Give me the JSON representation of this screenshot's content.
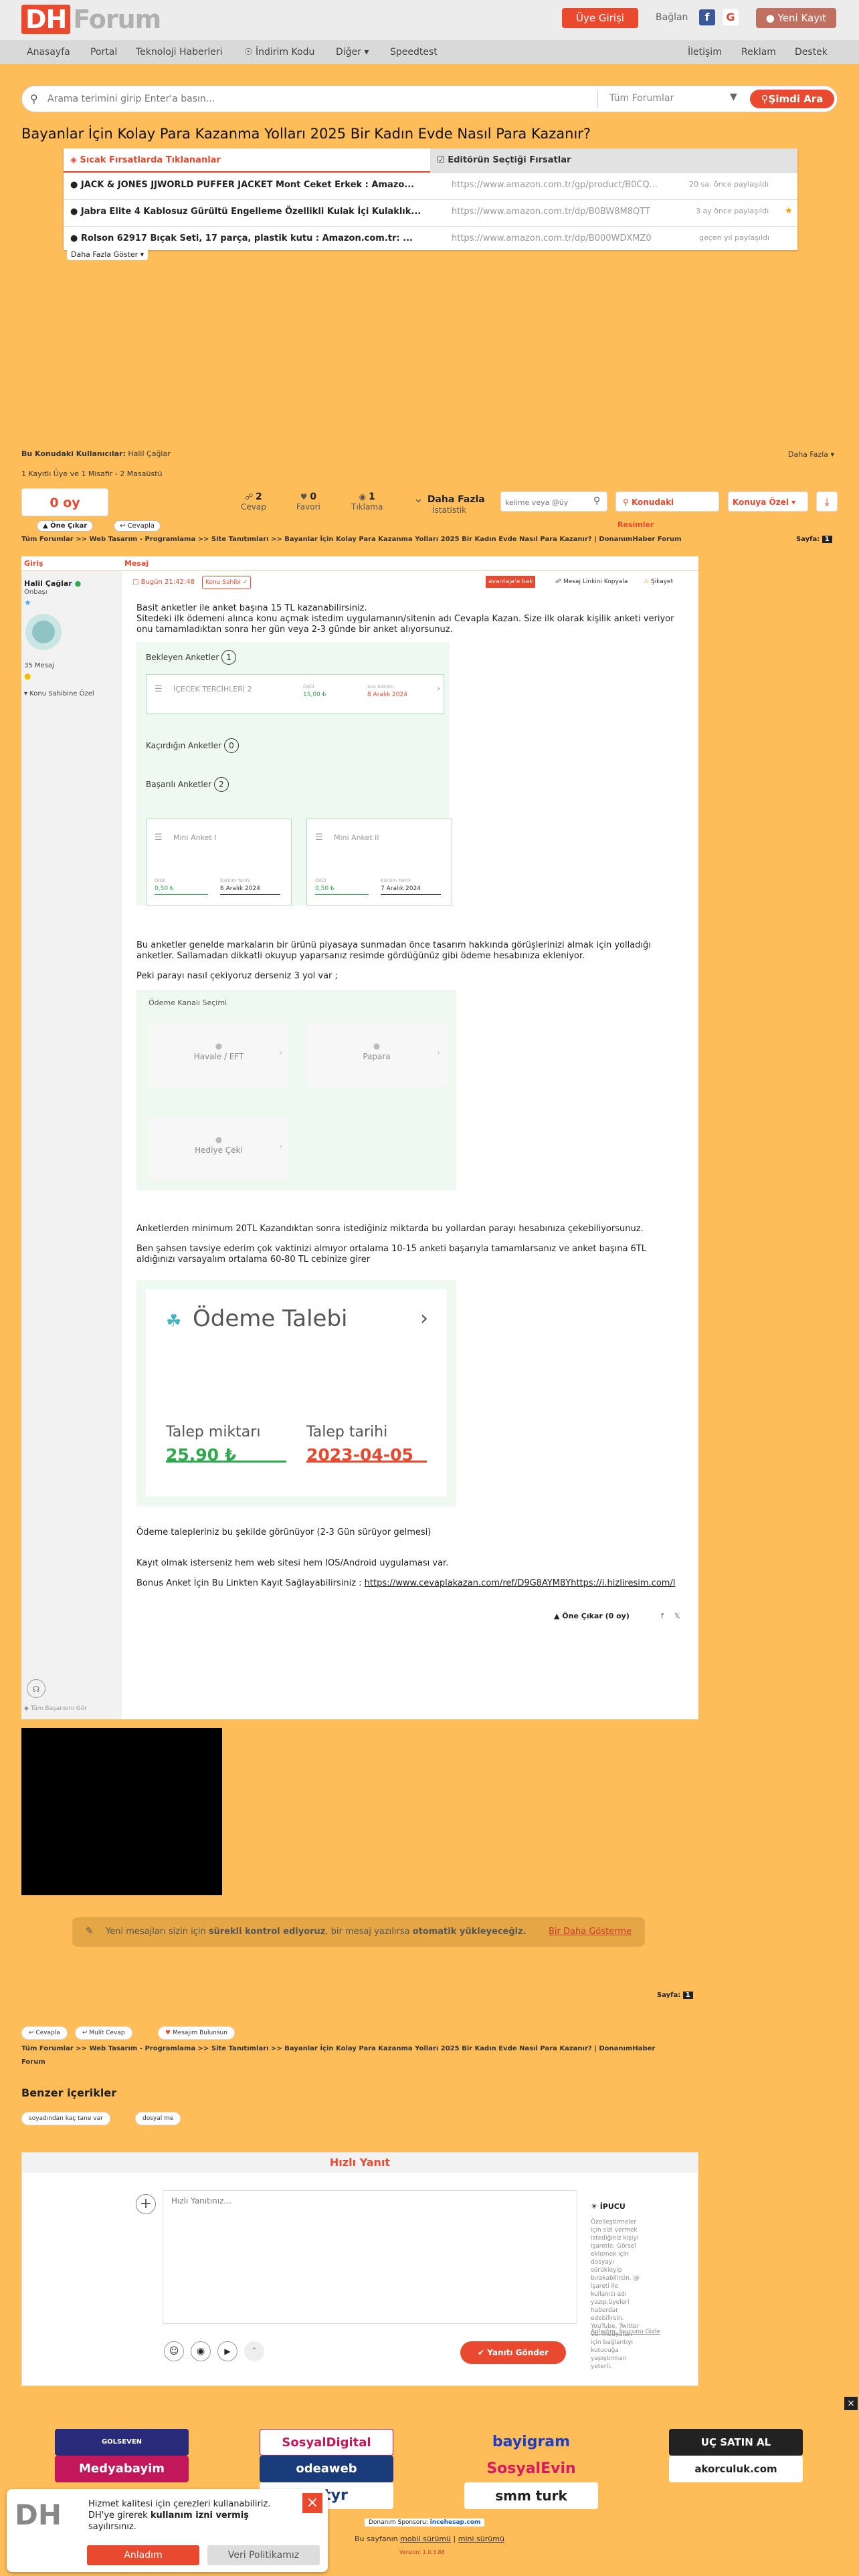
{
  "header": {
    "logo_dh": "DH",
    "logo_forum": "Forum",
    "login_button": "Üye Girişi",
    "connect_label": "Bağlan",
    "register_button": "Yeni Kayıt"
  },
  "nav": {
    "items": [
      "Anasayfa",
      "Portal",
      "Teknoloji Haberleri",
      "İndirim Kodu",
      "Diğer",
      "Speedtest"
    ],
    "right_items": [
      "İletişim",
      "Reklam",
      "Destek"
    ]
  },
  "search": {
    "placeholder": "Arama terimini girip Enter'a basın...",
    "scope": "Tüm Forumlar",
    "button": "Şimdi Ara"
  },
  "topic_title": "Bayanlar İçin Kolay Para Kazanma Yolları 2025 Bir Kadın Evde Nasıl Para Kazanır?",
  "hot_deals": {
    "tab_hot": "Sıcak Fırsatlarda Tıklananlar",
    "tab_editor": "Editörün Seçtiği Fırsatlar",
    "rows": [
      {
        "title": "JACK & JONES JJWORLD PUFFER JACKET Mont Ceket Erkek : Amazo...",
        "url": "https://www.amazon.com.tr/gp/product/B0CQ...",
        "time": "20 sa. önce paylaşıldı"
      },
      {
        "title": "Jabra Elite 4 Kablosuz Gürültü Engelleme Özellikli Kulak İçi Kulaklık...",
        "url": "https://www.amazon.com.tr/dp/B0BW8M8QTT",
        "time": "3 ay önce paylaşıldı"
      },
      {
        "title": "Rolson 62917 Bıçak Seti, 17 parça, plastik kutu : Amazon.com.tr: ...",
        "url": "https://www.amazon.com.tr/dp/B000WDXMZ0",
        "time": "geçen yıl paylaşıldı"
      }
    ],
    "more": "Daha Fazla Göster"
  },
  "viewers": {
    "label": "Bu Konudaki Kullanıcılar:",
    "user": "Halil Çağlar",
    "more": "Daha Fazla",
    "counts": "1 Kayıtlı Üye ve 1 Misafir - 2 Masaüstü"
  },
  "vote": {
    "score": "0 oy",
    "upvote": "Öne Çıkar",
    "answer": "Cevapla"
  },
  "stats": {
    "replies_value": "2",
    "replies_label": "Cevap",
    "favs_value": "0",
    "favs_label": "Favori",
    "clicks_value": "1",
    "clicks_label": "Tıklama",
    "more_label": "Daha Fazla",
    "more_sub": "İstatistik"
  },
  "topic_tools": {
    "keyword_placeholder": "kelime veya @üy",
    "subject_button": "Konudaki",
    "add_fav": "Konuya Özel",
    "images_label": "Resimler"
  },
  "breadcrumb": "Tüm Forumlar >> Web Tasarım - Programlama >> Site Tanıtımları >> Bayanlar İçin Kolay Para Kazanma Yolları 2025 Bir Kadın Evde Nasıl Para Kazanır? | DonanımHaber Forum",
  "breadcrumb_bottom": "Tüm Forumlar >> Web Tasarım - Programlama >> Site Tanıtımları >> Bayanlar İçin Kolay Para Kazanma Yolları 2025 Bir Kadın Evde Nasıl Para Kazanır? | DonanımHaber Forum",
  "page": {
    "label": "Sayfa:",
    "current": "1"
  },
  "post": {
    "col_user": "Giriş",
    "col_msg": "Mesaj",
    "date": "Bugün 21:42:48",
    "edit_badge": "Konu Sahibi",
    "warn": "avantaja'e bak",
    "copy_link": "Mesaj Linkini Kopyala",
    "report": "Şikayet",
    "username": "Halil Çağlar",
    "rank": "Onbaşı",
    "msg_count": "35 Mesaj",
    "user_menu": "Konu Sahibine Özel",
    "p1": "Basit anketler ile anket başına 15 TL kazanabilirsiniz.",
    "p2": "Sitedeki ilk ödemeni alınca konu açmak istedim uygulamanın/sitenin adı Cevapla Kazan. Size ilk olarak kişilik anketi veriyor onu tamamladıktan sonra her gün veya 2-3 günde bir anket alıyorsunuz.",
    "p3": "Bu anketler genelde markaların bir ürünü piyasaya sunmadan önce tasarım hakkında görüşlerinizi almak için yolladığı anketler. Sallamadan dikkatli okuyup yaparsanız resimde gördüğünüz gibi ödeme hesabınıza ekleniyor.",
    "p4": "Peki parayı nasıl çekiyoruz derseniz 3 yol var ;",
    "p5": "Anketlerden minimum 20TL Kazandıktan sonra istediğiniz miktarda bu yollardan parayı hesabınıza çekebiliyorsunuz.",
    "p6": "Ben şahsen tavsiye ederim çok vaktinizi almıyor ortalama 10-15 anketi başarıyla tamamlarsanız ve anket başına 6TL aldığınızı varsayalım ortalama 60-80 TL cebinize girer",
    "p7": "Ödeme talepleriniz bu şekilde görünüyor (2-3 Gün sürüyor gelmesi)",
    "p8": "Kayıt olmak isterseniz hem web sitesi hem IOS/Android uygulaması var.",
    "p9_label": "Bonus Anket İçin Bu Linkten Kayıt Sağlayabilirsiniz : ",
    "p9_link": "https://www.cevaplakazan.com/ref/D9G8AYM8Yhttps://i.hizliresim.com/l",
    "footer_upvote": "Öne Çıkar (0 oy)",
    "signature": "Tüm Başarısını Gör"
  },
  "survey_img": {
    "pending_title": "Bekleyen Anketler",
    "pending_count": "1",
    "pending_card": "İÇECEK TERCİHLERİ 2",
    "pending_val_label": "Ödül",
    "pending_val": "15,00 ₺",
    "pending_date_label": "Son Katılım",
    "pending_date": "8 Aralık 2024",
    "missed_title": "Kaçırdığın Anketler",
    "missed_count": "0",
    "success_title": "Başarılı Anketler",
    "success_count": "2",
    "card1": "Mini Anket I",
    "card2": "Mini Anket II",
    "card1_val": "0,50 ₺",
    "card1_date": "6 Aralık 2024",
    "card2_val": "0,50 ₺",
    "card2_date": "7 Aralık 2024",
    "c_label_a": "Ödül",
    "c_label_b": "Katılım Tarihi"
  },
  "payment_img": {
    "title": "Ödeme Kanalı Seçimi",
    "opt1": "Havale / EFT",
    "opt2": "Papara",
    "opt3": "Hediye Çeki"
  },
  "request_img": {
    "title": "Ödeme Talebi",
    "amount_label": "Talep miktarı",
    "amount": "25,90 ₺",
    "date_label": "Talep tarihi",
    "date": "2023-04-05"
  },
  "notice": {
    "text_a": "Yeni mesajları sizin için ",
    "text_b": "sürekli kontrol ediyoruz",
    "text_c": ", bir mesaj yazılırsa ",
    "text_d": "otomatik yükleyeceğiz.",
    "dismiss": "Bir Daha Gösterme"
  },
  "bottom_actions": [
    "Cevapla",
    "Mulit Cevap",
    "Mesajım Bulunsun"
  ],
  "related": {
    "title": "Benzer içerikler",
    "tags": [
      "soyadından kaç tane var",
      "dosyal me"
    ]
  },
  "quick_reply": {
    "title": "Hızlı Yanıt",
    "placeholder": "Hızlı Yanıtınız...",
    "tip_title": "İPUCU",
    "tip_text": "Özelleştirmeler için sizi vermek istediğiniz kişiyi işaretle. Görsel eklemek için dosyayı sürükleyip bırakabilirsin. @ işareti ile kullanıcı adı yazıp,üyeleri haberdar edebilirsin. YouTube, Twitter vb. medyaları için bağlantıyı kutucuğa yapıştırman yeterli.",
    "tip_link": "Anladım, İpucunu Gizle",
    "send": "Yanıtı Gönder"
  },
  "ads": [
    "GOLSEVEN",
    "SosyalDigital",
    "bayigram",
    "UÇ SATIN AL",
    "Medyabayim",
    "odeaweb",
    "SosyalEvin",
    "akorculuk.com",
    "astyr",
    "smm turk"
  ],
  "footer": {
    "sponsor_label": "Donanım Sponsoru:",
    "sponsor_name": "incehesap.com",
    "versions_a": "Bu sayfanın ",
    "versions_link1": "mobil sürümü",
    "versions_sep": " | ",
    "versions_link2": "mini sürümü",
    "version": "Version: 1.0.3.88"
  },
  "cookie": {
    "text_a": "Hizmet kalitesi için çerezleri kullanabiliriz. DH'ye girerek ",
    "text_b": "kullanım izni vermiş",
    "text_c": " sayılırsınız.",
    "accept": "Anladım",
    "policy": "Veri Politikamız"
  },
  "colors": {
    "accent": "#e8492f",
    "page_bg": "#ffbd59",
    "green": "#2fa84f"
  }
}
